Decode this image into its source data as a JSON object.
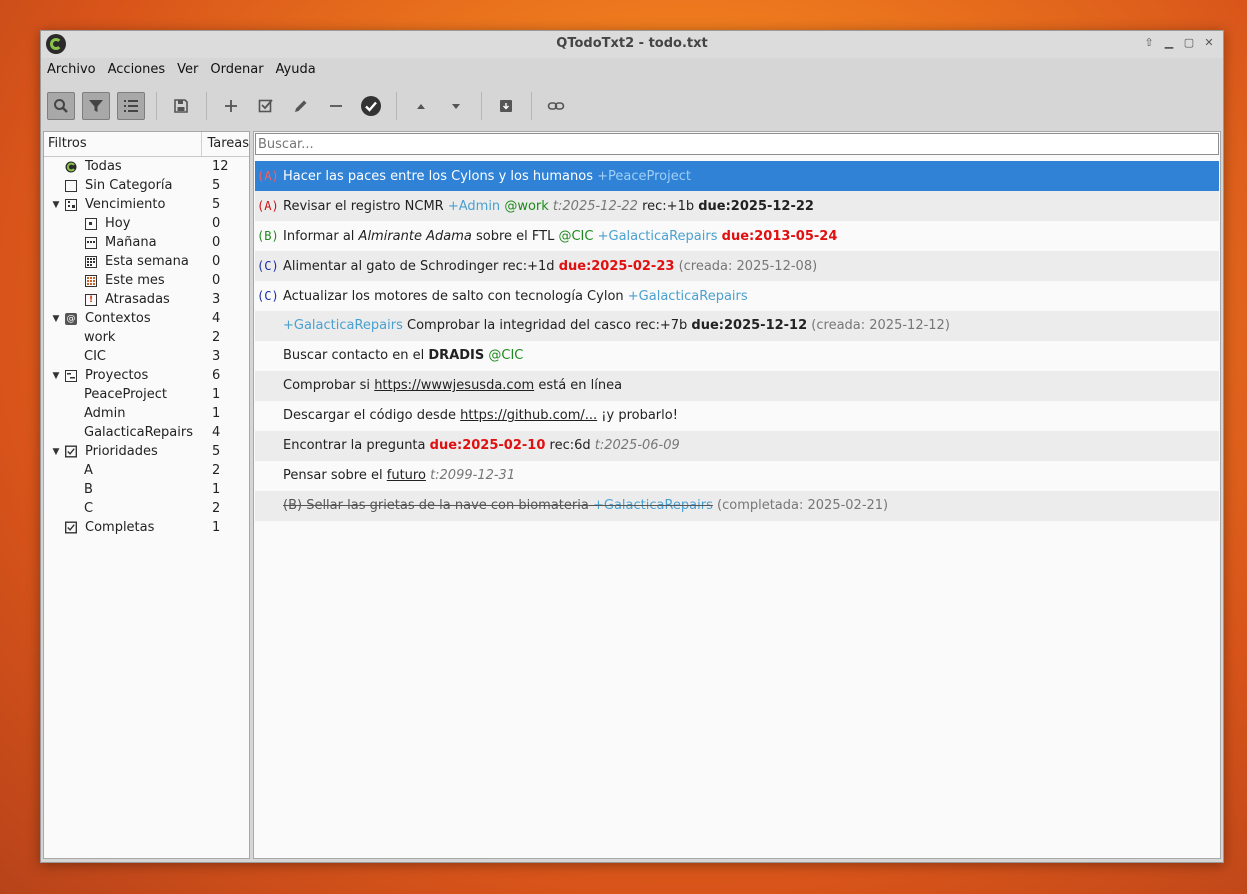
{
  "window": {
    "title": "QTodoTxt2 - todo.txt"
  },
  "menu": [
    "Archivo",
    "Acciones",
    "Ver",
    "Ordenar",
    "Ayuda"
  ],
  "search": {
    "placeholder": "Buscar..."
  },
  "filters": {
    "header_name": "Filtros",
    "header_count": "Tareas",
    "rows": [
      {
        "label": "Todas",
        "count": "12",
        "icon": "all-tasks-icon"
      },
      {
        "label": "Sin Categoría",
        "count": "5",
        "icon": "uncategorized-icon"
      },
      {
        "label": "Vencimiento",
        "count": "5",
        "icon": "due-calendar-icon"
      },
      {
        "label": "Hoy",
        "count": "0",
        "icon": "today-icon"
      },
      {
        "label": "Mañana",
        "count": "0",
        "icon": "tomorrow-icon"
      },
      {
        "label": "Esta semana",
        "count": "0",
        "icon": "this-week-icon"
      },
      {
        "label": "Este mes",
        "count": "0",
        "icon": "this-month-icon"
      },
      {
        "label": "Atrasadas",
        "count": "3",
        "icon": "overdue-icon"
      },
      {
        "label": "Contextos",
        "count": "4",
        "icon": "at-sign-icon"
      },
      {
        "label": "work",
        "count": "2"
      },
      {
        "label": "CIC",
        "count": "3"
      },
      {
        "label": "Proyectos",
        "count": "6",
        "icon": "projects-icon"
      },
      {
        "label": "PeaceProject",
        "count": "1"
      },
      {
        "label": "Admin",
        "count": "1"
      },
      {
        "label": "GalacticaRepairs",
        "count": "4"
      },
      {
        "label": "Prioridades",
        "count": "5",
        "icon": "priorities-check-icon"
      },
      {
        "label": "A",
        "count": "2"
      },
      {
        "label": "B",
        "count": "1"
      },
      {
        "label": "C",
        "count": "2"
      },
      {
        "label": "Completas",
        "count": "1",
        "icon": "completed-check-icon"
      }
    ]
  },
  "tasks": [
    {
      "priority": "(A)",
      "text": "Hacer las paces entre los Cylons y los humanos",
      "project": "+PeaceProject"
    },
    {
      "priority": "(A)",
      "text": "Revisar el registro NCMR",
      "project": "+Admin",
      "context": "@work",
      "threshold": "t:2025-12-22",
      "rec": "rec:+1b",
      "due": "due:2025-12-22"
    },
    {
      "priority": "(B)",
      "text1": "Informar al",
      "italic": "Almirante Adama",
      "text2": "sobre el FTL",
      "context": "@CIC",
      "project": "+GalacticaRepairs",
      "due": "due:2013-05-24"
    },
    {
      "priority": "(C)",
      "text": "Alimentar al gato de Schrodinger rec:+1d",
      "due": "due:2025-02-23",
      "meta": "(creada: 2025-12-08)"
    },
    {
      "priority": "(C)",
      "text": "Actualizar los motores de salto con tecnología Cylon",
      "project": "+GalacticaRepairs"
    },
    {
      "project": "+GalacticaRepairs",
      "text": "Comprobar la integridad del casco rec:+7b",
      "due": "due:2025-12-12",
      "meta": "(creada: 2025-12-12)"
    },
    {
      "text": "Buscar contacto en el",
      "bold": "DRADIS",
      "context": "@CIC"
    },
    {
      "text1": "Comprobar si",
      "link": "https://wwwjesusda.com",
      "text2": "está en línea"
    },
    {
      "text1": "Descargar el código desde",
      "link": "https://github.com/...",
      "text2": "¡y probarlo!"
    },
    {
      "text": "Encontrar la pregunta",
      "due": "due:2025-02-10",
      "rec": "rec:6d",
      "threshold": "t:2025-06-09"
    },
    {
      "text": "Pensar sobre el",
      "link": "futuro",
      "threshold": "t:2099-12-31"
    },
    {
      "text": "(B) Sellar las grietas de la nave con biomateria",
      "project": "+GalacticaRepairs",
      "meta": "(completada: 2025-02-21)"
    }
  ]
}
